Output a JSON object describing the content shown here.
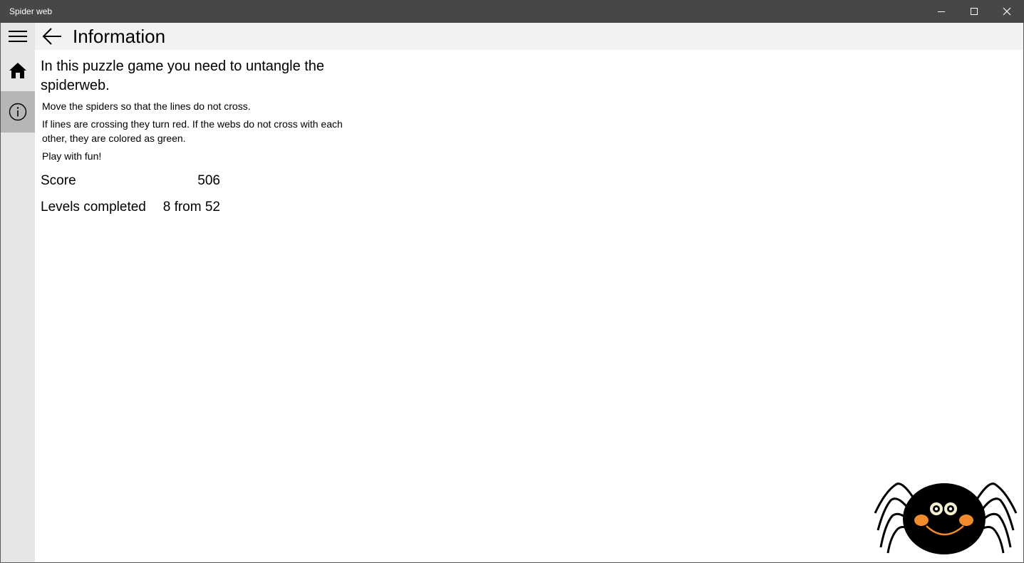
{
  "window": {
    "title": "Spider web",
    "controls": {
      "minimize_icon": "minimize-icon",
      "maximize_icon": "maximize-icon",
      "close_icon": "close-icon"
    }
  },
  "sidebar": {
    "items": [
      {
        "icon": "hamburger-menu-icon"
      },
      {
        "icon": "home-icon"
      },
      {
        "icon": "info-icon",
        "selected": true
      }
    ]
  },
  "header": {
    "back_icon": "back-arrow-icon",
    "title": "Information"
  },
  "main": {
    "heading": "In this puzzle game you need to untangle the spiderweb.",
    "paragraphs": [
      "Move the spiders so that the lines do not cross.",
      "If lines are crossing they turn red. If the webs do not cross with each other, they are colored as green.",
      "Play with fun!"
    ],
    "stats": {
      "score_label": "Score",
      "score_value": "506",
      "levels_label": "Levels completed",
      "levels_value": "8 from 52"
    }
  },
  "colors": {
    "titlebar": "#474747",
    "sidebar": "#e6e6e6",
    "sidebar_selected": "#b6b6b6",
    "header": "#f2f2f2",
    "spider_cheek": "#f28b2c"
  }
}
